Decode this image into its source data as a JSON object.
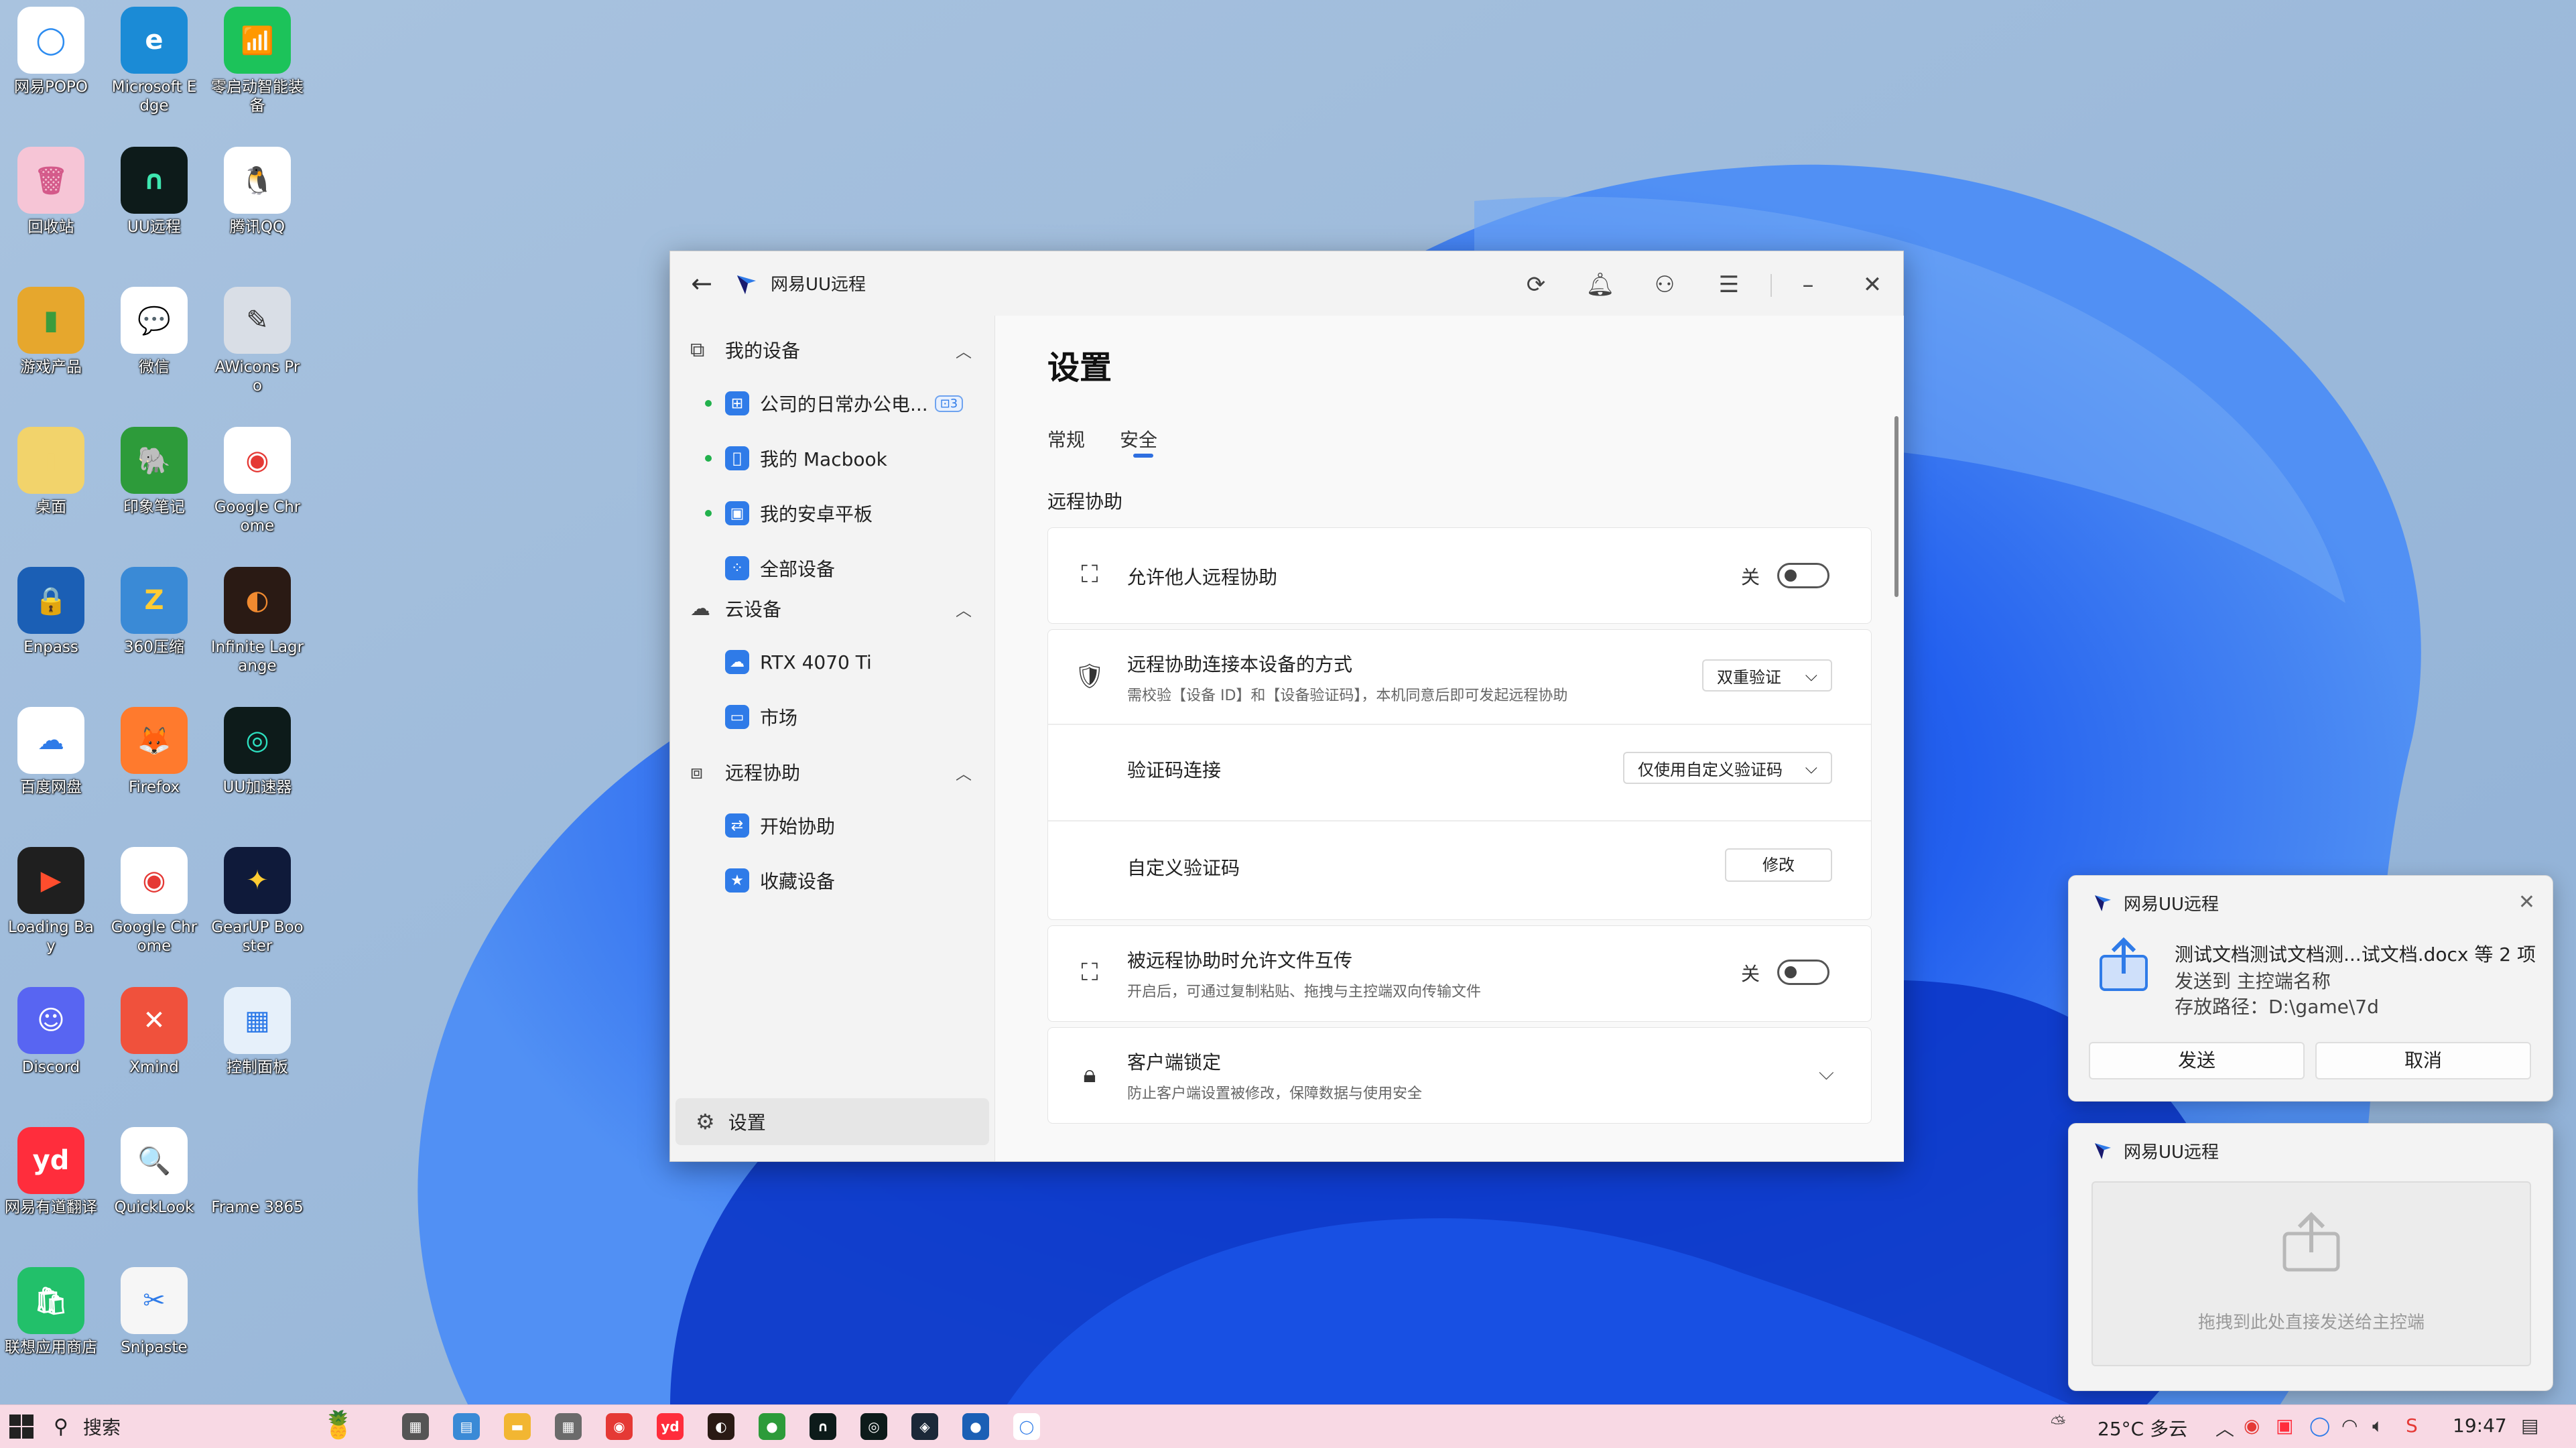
{
  "desktop": {
    "icons": [
      {
        "label": "网易POPO",
        "glyph": "◯",
        "color": "#ffffff",
        "fg": "#2d8cf0"
      },
      {
        "label": "Microsoft Edge",
        "glyph": "e",
        "color": "#1b8bd6",
        "fg": "#ffffff"
      },
      {
        "label": "零启动智能装备",
        "glyph": "📶",
        "color": "#1cc35a",
        "fg": "#ffffff"
      },
      {
        "label": "回收站",
        "glyph": "🗑",
        "color": "#f6c5d6",
        "fg": "#d45a8a"
      },
      {
        "label": "UU远程",
        "glyph": "∩",
        "color": "#0d1b1a",
        "fg": "#3ee6b0"
      },
      {
        "label": "腾讯QQ",
        "glyph": "🐧",
        "color": "#ffffff",
        "fg": "#000000"
      },
      {
        "label": "游戏产品",
        "glyph": "▮",
        "color": "#e6a72d",
        "fg": "#3c9c3c"
      },
      {
        "label": "微信",
        "glyph": "💬",
        "color": "#ffffff",
        "fg": "#2dc100"
      },
      {
        "label": "AWicons Pro",
        "glyph": "✎",
        "color": "#d9dee6",
        "fg": "#333333"
      },
      {
        "label": "桌面",
        "glyph": "▯",
        "color": "#f2d36b",
        "fg": "#f2d36b"
      },
      {
        "label": "印象笔记",
        "glyph": "🐘",
        "color": "#2d9b3a",
        "fg": "#ffffff"
      },
      {
        "label": "Google Chrome",
        "glyph": "◉",
        "color": "#ffffff",
        "fg": "#e53935"
      },
      {
        "label": "Enpass",
        "glyph": "🔒",
        "color": "#1b5fb5",
        "fg": "#ffffff"
      },
      {
        "label": "360压缩",
        "glyph": "Z",
        "color": "#3a8ad6",
        "fg": "#ffcc33"
      },
      {
        "label": "Infinite Lagrange",
        "glyph": "◐",
        "color": "#2a1a14",
        "fg": "#f08a30"
      },
      {
        "label": "百度网盘",
        "glyph": "☁",
        "color": "#ffffff",
        "fg": "#2f7be8"
      },
      {
        "label": "Firefox",
        "glyph": "🦊",
        "color": "#ff7a2d",
        "fg": "#ffffff"
      },
      {
        "label": "UU加速器",
        "glyph": "◎",
        "color": "#0d1b1a",
        "fg": "#2de0c0"
      },
      {
        "label": "Loading Bay",
        "glyph": "▶",
        "color": "#1f1f1f",
        "fg": "#ff4d2d"
      },
      {
        "label": "Google Chrome",
        "glyph": "◉",
        "color": "#ffffff",
        "fg": "#e53935"
      },
      {
        "label": "GearUP Booster",
        "glyph": "✦",
        "color": "#0f1a3a",
        "fg": "#ffcc33"
      },
      {
        "label": "Discord",
        "glyph": "☺",
        "color": "#5865f2",
        "fg": "#ffffff"
      },
      {
        "label": "Xmind",
        "glyph": "✕",
        "color": "#f0513c",
        "fg": "#ffffff"
      },
      {
        "label": "控制面板",
        "glyph": "▦",
        "color": "#e6f0fa",
        "fg": "#2f7be8"
      },
      {
        "label": "网易有道翻译",
        "glyph": "yd",
        "color": "#ff2d3c",
        "fg": "#ffffff"
      },
      {
        "label": "QuickLook",
        "glyph": "🔍",
        "color": "#ffffff",
        "fg": "#2f7be8"
      },
      {
        "label": "Frame 3865",
        "glyph": "",
        "color": "transparent",
        "fg": "#ffffff"
      },
      {
        "label": "联想应用商店",
        "glyph": "🛍",
        "color": "#22c06a",
        "fg": "#ffffff"
      },
      {
        "label": "Snipaste",
        "glyph": "✂",
        "color": "#f6f6f6",
        "fg": "#2f7be8"
      }
    ]
  },
  "window": {
    "title": "网易UU远程",
    "sidebar": {
      "my_devices": "我的设备",
      "device_items": [
        {
          "label": "公司的日常办公电...",
          "badge": "⊡3",
          "online": true,
          "icon_color": "#2f7be8",
          "glyph": "⊞"
        },
        {
          "label": "我的 Macbook",
          "online": true,
          "icon_color": "#2f7be8",
          "glyph": ""
        },
        {
          "label": "我的安卓平板",
          "online": true,
          "icon_color": "#2f7be8",
          "glyph": "▣"
        },
        {
          "label": "全部设备",
          "online": false,
          "icon_color": "#2f7be8",
          "glyph": "⁘"
        }
      ],
      "cloud_devices": "云设备",
      "cloud_items": [
        {
          "label": "RTX 4070 Ti",
          "icon_color": "#2f7be8",
          "glyph": "☁"
        },
        {
          "label": "市场",
          "icon_color": "#2f7be8",
          "glyph": "▭"
        }
      ],
      "remote_assist": "远程协助",
      "assist_items": [
        {
          "label": "开始协助",
          "icon_color": "#2f7be8",
          "glyph": "⇄"
        },
        {
          "label": "收藏设备",
          "icon_color": "#2f7be8",
          "glyph": "★"
        }
      ],
      "settings": "设置"
    },
    "content": {
      "title": "设置",
      "tabs": [
        "常规",
        "安全"
      ],
      "active_tab": "安全",
      "section": "远程协助",
      "rows": {
        "allow_remote": {
          "title": "允许他人远程协助",
          "toggle_label": "关"
        },
        "connect_method": {
          "title": "远程协助连接本设备的方式",
          "sub": "需校验【设备 ID】和【设备验证码】，本机同意后即可发起远程协助",
          "value": "双重验证"
        },
        "code_connect": {
          "title": "验证码连接",
          "value": "仅使用自定义验证码"
        },
        "custom_code": {
          "title": "自定义验证码",
          "button": "修改"
        },
        "file_transfer": {
          "title": "被远程协助时允许文件互传",
          "sub": "开启后，可通过复制粘贴、拖拽与主控端双向传输文件",
          "toggle_label": "关"
        },
        "client_lock": {
          "title": "客户端锁定",
          "sub": "防止客户端设置被修改，保障数据与使用安全"
        }
      }
    }
  },
  "notification_send": {
    "app": "网易UU远程",
    "file_line": "测试文档测试文档测...试文档.docx 等 2 项",
    "sent_to": "发送到 主控端名称",
    "path": "存放路径：D:\\game\\7d",
    "send_button": "发送",
    "cancel_button": "取消"
  },
  "notification_drop": {
    "app": "网易UU远程",
    "hint": "拖拽到此处直接发送给主控端"
  },
  "taskbar": {
    "search": "搜索",
    "weather": "25°C 多云",
    "time": "19:47",
    "apps": [
      {
        "name": "task-view",
        "color": "#555555",
        "glyph": "▦"
      },
      {
        "name": "control-panel",
        "color": "#3a8ad6",
        "glyph": "▤"
      },
      {
        "name": "file-explorer",
        "color": "#f2b632",
        "glyph": "▬"
      },
      {
        "name": "calculator",
        "color": "#6b6b6b",
        "glyph": "▦"
      },
      {
        "name": "chrome",
        "color": "#e53935",
        "glyph": "◉"
      },
      {
        "name": "youdao",
        "color": "#ff2d3c",
        "glyph": "yd"
      },
      {
        "name": "app-dark",
        "color": "#2a1a14",
        "glyph": "◐"
      },
      {
        "name": "app-green",
        "color": "#2d9b3a",
        "glyph": "●"
      },
      {
        "name": "uu-remote",
        "color": "#0d1b1a",
        "glyph": "∩"
      },
      {
        "name": "uu-booster",
        "color": "#0d1b1a",
        "glyph": "◎"
      },
      {
        "name": "steam",
        "color": "#1b2838",
        "glyph": "◈"
      },
      {
        "name": "enpass",
        "color": "#1b5fb5",
        "glyph": "●"
      },
      {
        "name": "popo",
        "color": "#ffffff",
        "glyph": "◯"
      }
    ]
  }
}
